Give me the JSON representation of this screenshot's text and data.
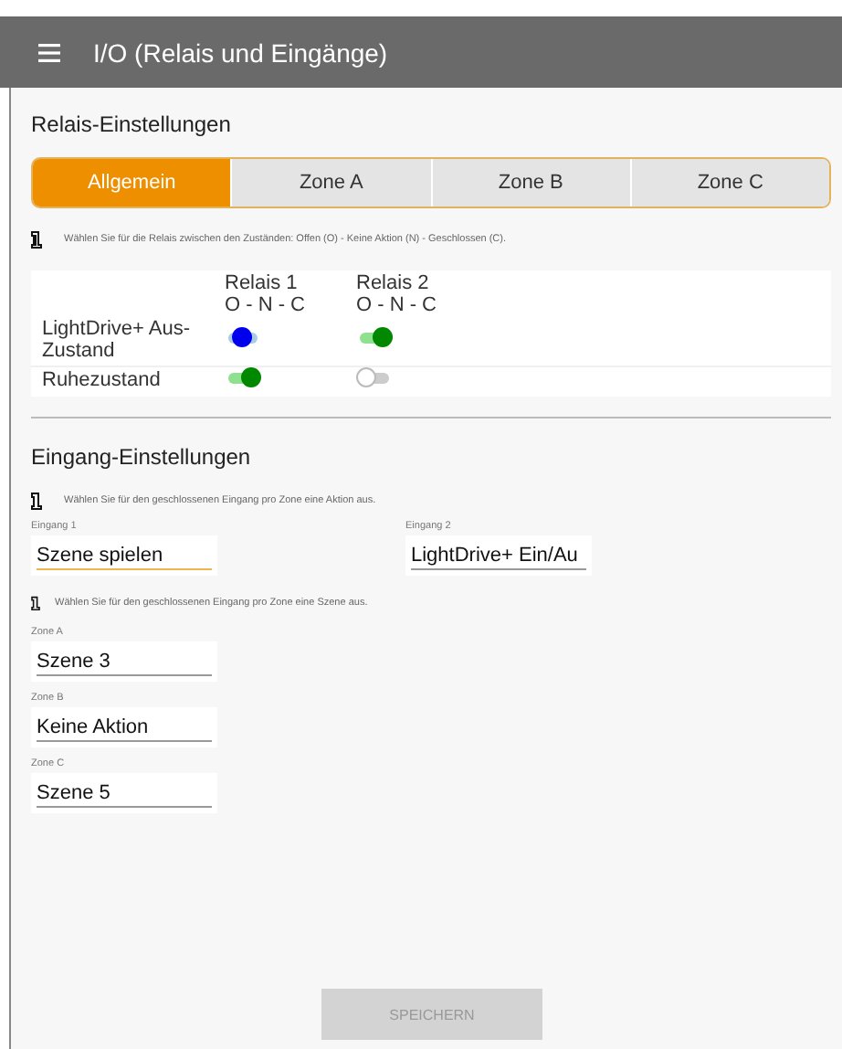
{
  "app_bar": {
    "title": "I/O (Relais und Eingänge)"
  },
  "relay_section": {
    "heading": "Relais-Einstellungen",
    "tabs": [
      {
        "label": "Allgemein",
        "selected": true
      },
      {
        "label": "Zone A",
        "selected": false
      },
      {
        "label": "Zone B",
        "selected": false
      },
      {
        "label": "Zone C",
        "selected": false
      }
    ],
    "info": "Wählen Sie für die Relais zwischen den Zuständen: Offen (O) - Keine Aktion (N) - Geschlossen (C).",
    "columns": [
      {
        "name": "Relais 1",
        "legend": "O - N - C"
      },
      {
        "name": "Relais 2",
        "legend": "O - N - C"
      }
    ],
    "rows": [
      {
        "label": "LightDrive+ Aus-Zustand",
        "switches": [
          {
            "on": false,
            "neutral": true
          },
          {
            "on": true,
            "neutral": false
          }
        ]
      },
      {
        "label": "Ruhezustand",
        "switches": [
          {
            "on": true,
            "neutral": false
          },
          {
            "on": false,
            "neutral": false
          }
        ]
      }
    ]
  },
  "input_section": {
    "heading": "Eingang-Einstellungen",
    "info": "Wählen Sie für den geschlossenen Eingang pro Zone eine Aktion aus.",
    "inputs": [
      {
        "label": "Eingang 1",
        "value": "Szene spielen",
        "focused": true
      },
      {
        "label": "Eingang 2",
        "value": "LightDrive+ Ein/Au",
        "focused": false
      }
    ],
    "scene_info": "Wählen Sie für den geschlossenen Eingang pro Zone eine Szene aus.",
    "zones": [
      {
        "label": "Zone A",
        "value": "Szene 3",
        "focused": false
      },
      {
        "label": "Zone B",
        "value": "Keine Aktion",
        "focused": false
      },
      {
        "label": "Zone C",
        "value": "Szene 5",
        "focused": false
      }
    ]
  },
  "save_button": {
    "label": "SPEICHERN",
    "disabled": true
  }
}
